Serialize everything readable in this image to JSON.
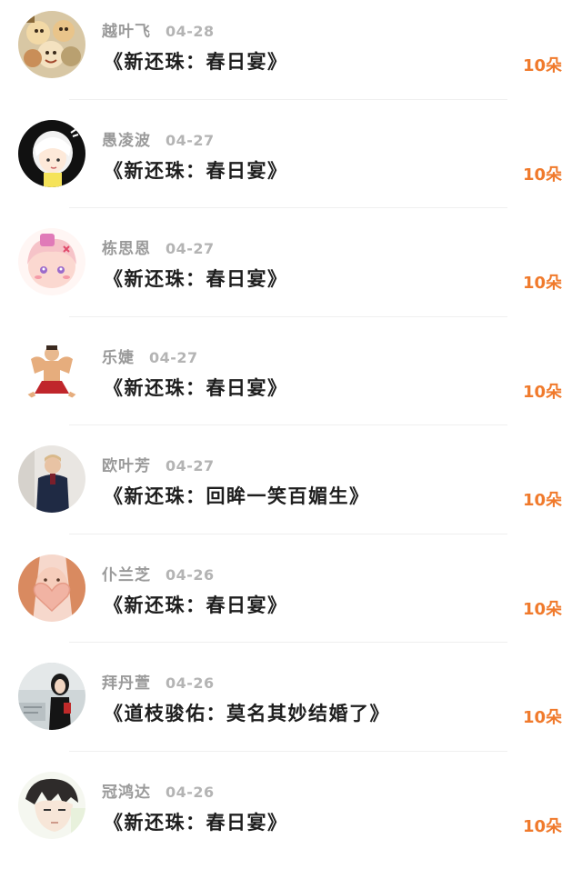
{
  "unit": "朵",
  "items": [
    {
      "name": "越叶飞",
      "date": "04-28",
      "title": "《新还珠：春日宴》",
      "count": "10朵",
      "avatar": "cartoon-group-avatar"
    },
    {
      "name": "愚凌波",
      "date": "04-27",
      "title": "《新还珠：春日宴》",
      "count": "10朵",
      "avatar": "white-hair-girl-avatar"
    },
    {
      "name": "栋思恩",
      "date": "04-27",
      "title": "《新还珠：春日宴》",
      "count": "10朵",
      "avatar": "anime-pink-girl-avatar"
    },
    {
      "name": "乐婕",
      "date": "04-27",
      "title": "《新还珠：春日宴》",
      "count": "10朵",
      "avatar": "muscle-man-avatar"
    },
    {
      "name": "欧叶芳",
      "date": "04-27",
      "title": "《新还珠：回眸一笑百媚生》",
      "count": "10朵",
      "avatar": "man-photo-avatar"
    },
    {
      "name": "仆兰芝",
      "date": "04-26",
      "title": "《新还珠：春日宴》",
      "count": "10朵",
      "avatar": "heart-hands-avatar"
    },
    {
      "name": "拜丹萱",
      "date": "04-26",
      "title": "《道枝骏佑：莫名其妙结婚了》",
      "count": "10朵",
      "avatar": "girl-photo-avatar"
    },
    {
      "name": "冠鸿达",
      "date": "04-26",
      "title": "《新还珠：春日宴》",
      "count": "10朵",
      "avatar": "anime-boy-avatar"
    }
  ]
}
